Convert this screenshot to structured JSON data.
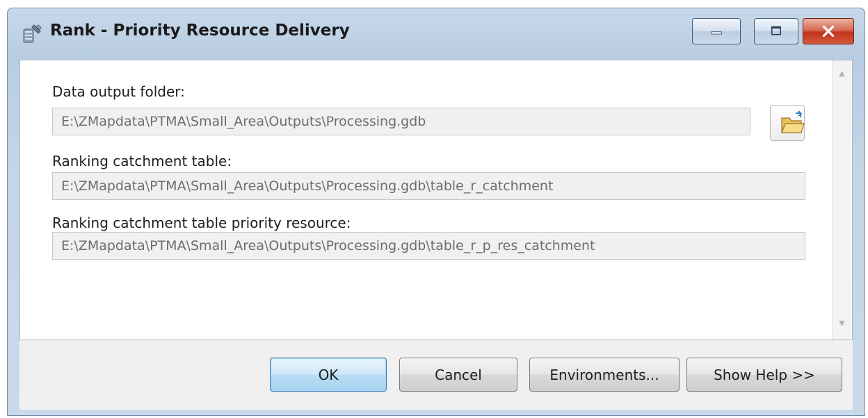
{
  "window": {
    "title": "Rank - Priority Resource Delivery"
  },
  "fields": [
    {
      "label": "Data output folder:",
      "value": "E:\\ZMapdata\\PTMA\\Small_Area\\Outputs\\Processing.gdb"
    },
    {
      "label": "Ranking catchment table:",
      "value": "E:\\ZMapdata\\PTMA\\Small_Area\\Outputs\\Processing.gdb\\table_r_catchment"
    },
    {
      "label": "Ranking catchment table priority resource:",
      "value": "E:\\ZMapdata\\PTMA\\Small_Area\\Outputs\\Processing.gdb\\table_r_p_res_catchment"
    }
  ],
  "buttons": {
    "ok": "OK",
    "cancel": "Cancel",
    "environments": "Environments...",
    "show_help": "Show Help >>"
  },
  "icons": {
    "app": "toolbox-script-icon",
    "minimize": "minimize-icon",
    "maximize": "maximize-icon",
    "close": "close-icon",
    "browse": "open-folder-icon",
    "scroll_up": "scroll-up-arrow-icon",
    "scroll_down": "scroll-down-arrow-icon"
  },
  "colors": {
    "frame": "#c4d5e6",
    "close_button": "#c2341b",
    "ok_button": "#b6dcf5",
    "field_background": "#f0f0f0",
    "field_text": "#6d6d6d"
  }
}
